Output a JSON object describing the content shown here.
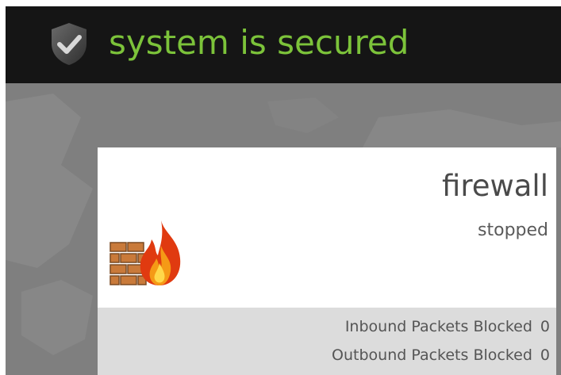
{
  "status": {
    "text": "system is secured",
    "icon": "shield-check-icon",
    "color": "#7cc33a"
  },
  "firewall": {
    "title": "firewall",
    "state": "stopped",
    "icon": "firewall-icon"
  },
  "stats": [
    {
      "label": "Inbound Packets Blocked",
      "value": "0"
    },
    {
      "label": "Outbound Packets Blocked",
      "value": "0"
    }
  ]
}
